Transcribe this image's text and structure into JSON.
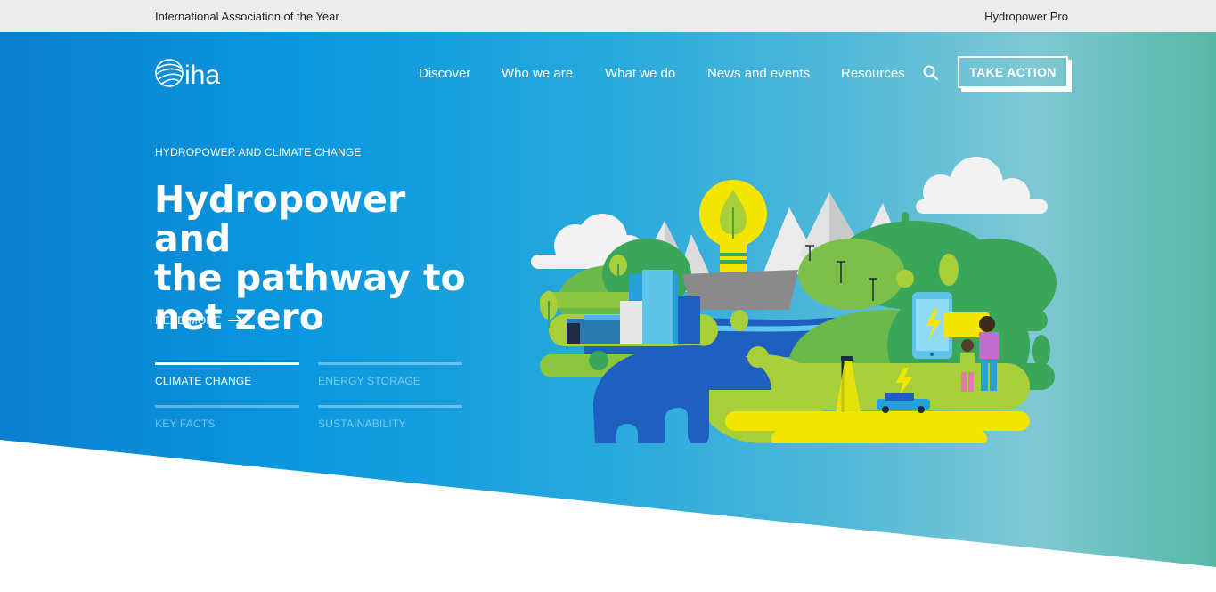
{
  "topbar": {
    "left_label": "International Association of the Year",
    "right_link": "Hydropower Pro"
  },
  "header": {
    "logo_text": "iha",
    "nav": [
      {
        "label": "Discover"
      },
      {
        "label": "Who we are"
      },
      {
        "label": "What we do"
      },
      {
        "label": "News and events"
      },
      {
        "label": "Resources"
      }
    ],
    "search_icon": "search-icon",
    "cta_label": "TAKE ACTION"
  },
  "hero": {
    "eyebrow": "HYDROPOWER AND CLIMATE CHANGE",
    "headline_lines": [
      "Hydropower and",
      "the pathway to",
      "net zero"
    ],
    "read_more": "READ MORE",
    "read_more_icon": "arrow-right-icon",
    "tabs": [
      {
        "label": "CLIMATE CHANGE",
        "active": true
      },
      {
        "label": "ENERGY STORAGE",
        "active": false
      },
      {
        "label": "KEY FACTS",
        "active": false
      },
      {
        "label": "SUSTAINABILITY",
        "active": false
      }
    ]
  },
  "colors": {
    "gradient_start": "#0a7fcf",
    "gradient_end": "#57b8a6",
    "topbar_bg": "#ececec",
    "white": "#ffffff"
  }
}
